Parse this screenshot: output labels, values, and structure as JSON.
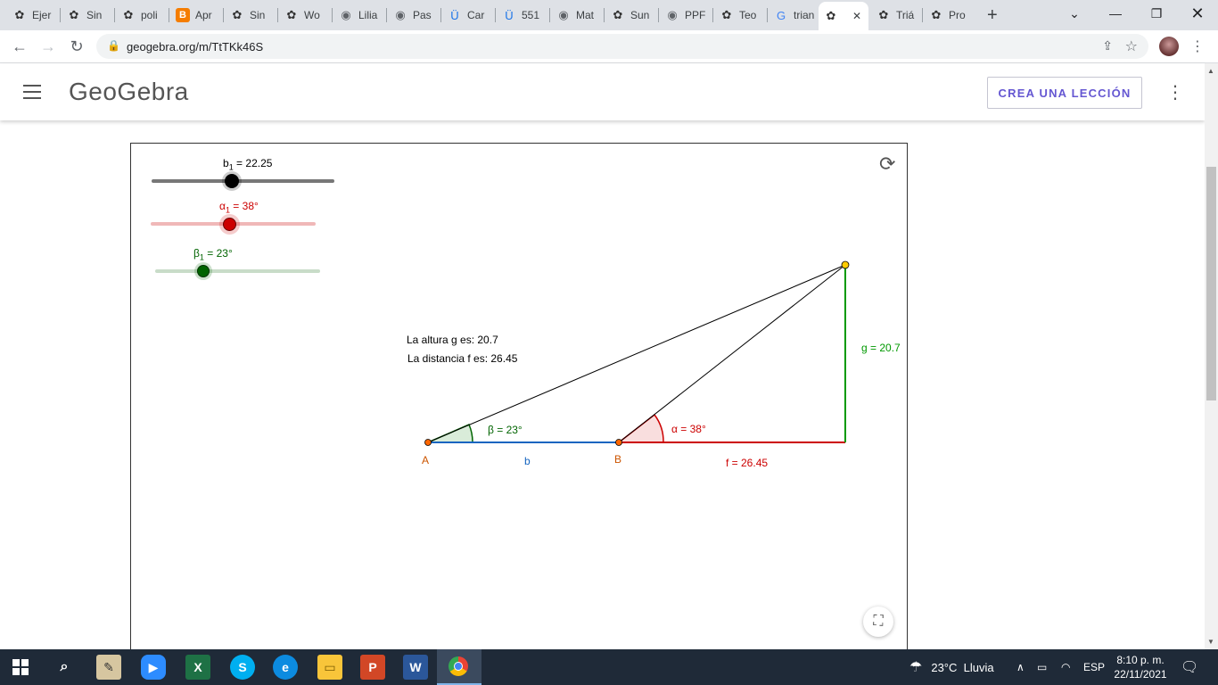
{
  "browser": {
    "tabs": [
      {
        "label": "Ejer",
        "icon": "geogebra-icon"
      },
      {
        "label": "Sin",
        "icon": "geogebra-icon"
      },
      {
        "label": "poli",
        "icon": "geogebra-icon"
      },
      {
        "label": "Apr",
        "icon": "blogger-icon"
      },
      {
        "label": "Sin",
        "icon": "geogebra-icon"
      },
      {
        "label": "Wo",
        "icon": "geogebra-icon"
      },
      {
        "label": "Lilia",
        "icon": "globe-icon"
      },
      {
        "label": "Pas",
        "icon": "globe-icon"
      },
      {
        "label": "Car",
        "icon": "u-icon"
      },
      {
        "label": "551",
        "icon": "u-icon"
      },
      {
        "label": "Mat",
        "icon": "globe-icon"
      },
      {
        "label": "Sun",
        "icon": "geogebra-icon"
      },
      {
        "label": "PPF",
        "icon": "globe-icon"
      },
      {
        "label": "Teo",
        "icon": "geogebra-icon"
      },
      {
        "label": "trian",
        "icon": "google-icon"
      },
      {
        "label": "",
        "icon": "geogebra-icon"
      },
      {
        "label": "Triá",
        "icon": "geogebra-icon"
      },
      {
        "label": "Pro",
        "icon": "geogebra-icon"
      }
    ],
    "url": "geogebra.org/m/TtTKk46S"
  },
  "header": {
    "logo": "GeoGebra",
    "cta_label": "CREA UNA LECCIÓN"
  },
  "applet": {
    "sliders": [
      {
        "label": "b",
        "sub": "1",
        "value": "= 22.25",
        "color": "#000000"
      },
      {
        "label": "α",
        "sub": "1",
        "value": "= 38°",
        "color": "#cc0000"
      },
      {
        "label": "β",
        "sub": "1",
        "value": "= 23°",
        "color": "#006400"
      }
    ],
    "text_height": "La altura g es: 20.7",
    "text_distance": "La distancia f es: 26.45",
    "label_g": "g = 20.7",
    "label_beta": "β = 23°",
    "label_alpha": "α = 38°",
    "label_A": "A",
    "label_B": "B",
    "label_b": "b",
    "label_f": "f = 26.45"
  },
  "taskbar": {
    "weather": "23°C  Lluvia",
    "lang": "ESP",
    "time": "8:10 p. m.",
    "date": "22/11/2021"
  },
  "colors": {
    "blue": "#1565c0",
    "red": "#cc0000",
    "green": "#009900",
    "orange": "#cc5500",
    "accent": "#6557d2"
  }
}
